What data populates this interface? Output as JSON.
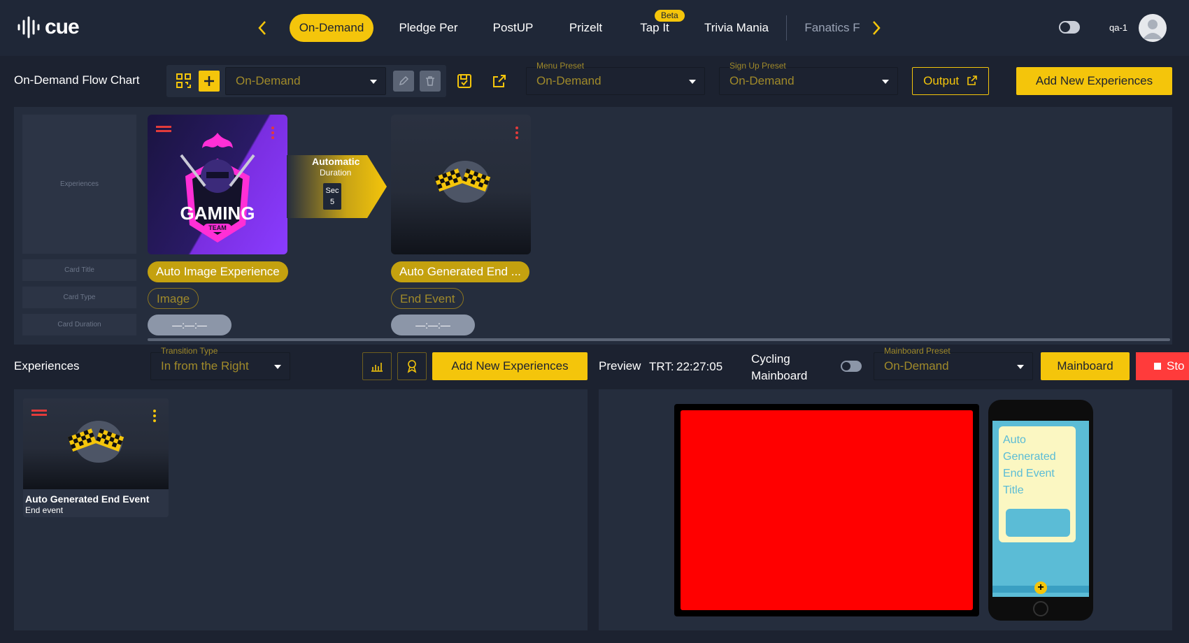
{
  "brand": {
    "name": "cue"
  },
  "nav": {
    "tabs": [
      {
        "label": "On-Demand",
        "active": true
      },
      {
        "label": "Pledge Per"
      },
      {
        "label": "PostUP"
      },
      {
        "label": "Prizelt"
      },
      {
        "label": "Tap It",
        "badge": "Beta"
      },
      {
        "label": "Trivia Mania"
      },
      {
        "label": "Fanatics F"
      }
    ],
    "user": "qa-1"
  },
  "toolbar": {
    "title": "On-Demand Flow Chart",
    "flow_select": "On-Demand",
    "menu_preset": {
      "caption": "Menu Preset",
      "value": "On-Demand"
    },
    "signup_preset": {
      "caption": "Sign Up Preset",
      "value": "On-Demand"
    },
    "output_label": "Output",
    "add_label": "Add New Experiences"
  },
  "flow": {
    "row_labels": {
      "experiences": "Experiences",
      "card_title": "Card Title",
      "card_type": "Card Type",
      "card_duration": "Card Duration"
    },
    "cards": [
      {
        "title": "Auto Image Experience",
        "type": "Image",
        "duration": "—:—:—",
        "art_text": "GAMING",
        "art_sub": "TEAM"
      },
      {
        "title": "Auto Generated End ...",
        "type": "End Event",
        "duration": "—:—:—"
      }
    ],
    "transition": {
      "mode": "Automatic",
      "kind": "Duration",
      "unit": "Sec",
      "value": "5"
    }
  },
  "experiences": {
    "title": "Experiences",
    "transition_type": {
      "caption": "Transition Type",
      "value": "In from the Right"
    },
    "add_label": "Add New Experiences",
    "items": [
      {
        "title": "Auto Generated End Event",
        "subtitle": "End event"
      }
    ]
  },
  "preview": {
    "label": "Preview",
    "trt_label": "TRT:",
    "trt_value": "22:27:05",
    "cycling_label": "Cycling Mainboard",
    "mainboard_preset": {
      "caption": "Mainboard Preset",
      "value": "On-Demand"
    },
    "mainboard_label": "Mainboard",
    "stop_label": "Sto",
    "phone_card_text": "Auto Generated End Event Title",
    "colors": {
      "screen": "#ff0000",
      "phone_bg": "#5bbcd6",
      "phone_card": "#fbf7c2"
    }
  }
}
